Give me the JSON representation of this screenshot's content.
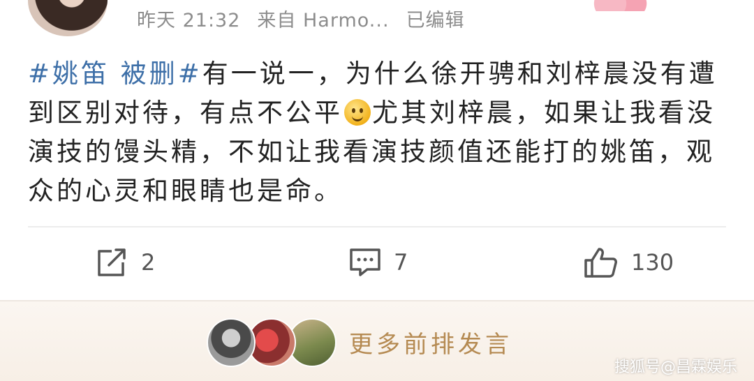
{
  "post": {
    "meta": {
      "time": "昨天 21:32",
      "source": "来自 Harmo...",
      "edited": "已编辑"
    },
    "hashtag": "#姚笛 被删#",
    "text_before_emoji": "有一说一，为什么徐开骋和刘梓晨没有遭到区别对待，有点不公平",
    "emoji": "smile-emoji",
    "text_after_emoji": "尤其刘梓晨，如果让我看没演技的馒头精，不如让我看演技颜值还能打的姚笛，观众的心灵和眼睛也是命。"
  },
  "actions": {
    "share_count": "2",
    "comment_count": "7",
    "like_count": "130"
  },
  "footer": {
    "more_comments": "更多前排发言"
  },
  "watermark": "搜狐号@昌霖娱乐",
  "colors": {
    "hashtag": "#3d6fa8",
    "meta": "#8c8c8c",
    "more_link": "#b58a52"
  }
}
